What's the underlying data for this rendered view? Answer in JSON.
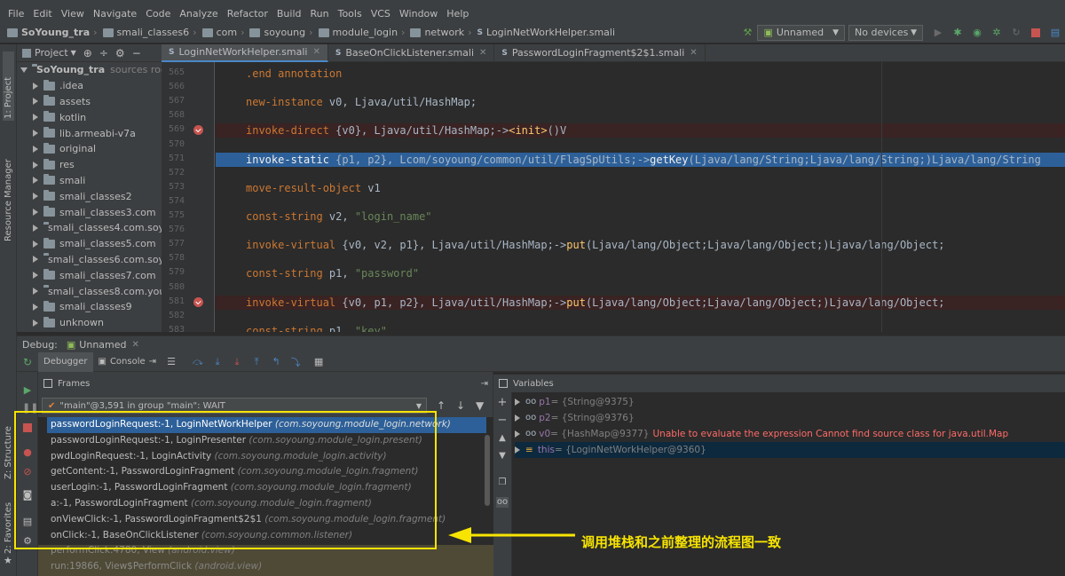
{
  "menu": [
    "File",
    "Edit",
    "View",
    "Navigate",
    "Code",
    "Analyze",
    "Refactor",
    "Build",
    "Run",
    "Tools",
    "VCS",
    "Window",
    "Help"
  ],
  "breadcrumbs": [
    "SoYoung_tra",
    "smali_classes6",
    "com",
    "soyoung",
    "module_login",
    "network",
    "LoginNetWorkHelper.smali"
  ],
  "toolbar": {
    "run_config": "Unnamed",
    "device": "No devices"
  },
  "project": {
    "header": "Project",
    "root": "SoYoung_tra",
    "root_suffix": "sources root",
    "items": [
      ".idea",
      "assets",
      "kotlin",
      "lib.armeabi-v7a",
      "original",
      "res",
      "smali",
      "smali_classes2",
      "smali_classes3.com",
      "smali_classes4.com.soy",
      "smali_classes5.com",
      "smali_classes6.com.soy",
      "smali_classes7.com",
      "smali_classes8.com.you",
      "smali_classes9",
      "unknown"
    ]
  },
  "side_tabs": {
    "project": "1: Project",
    "resource": "Resource Manager",
    "structure": "Z: Structure",
    "favorites": "2: Favorites"
  },
  "editor": {
    "tabs": [
      "LoginNetWorkHelper.smali",
      "BaseOnClickListener.smali",
      "PasswordLoginFragment$2$1.smali"
    ],
    "lines": [
      {
        "n": "565",
        "t": ".end annotation"
      },
      {
        "n": "566",
        "t": ""
      },
      {
        "n": "567",
        "t": "new-instance v0, Ljava/util/HashMap;"
      },
      {
        "n": "568",
        "t": ""
      },
      {
        "n": "569",
        "t": "invoke-direct {v0}, Ljava/util/HashMap;-><init>()V",
        "bp": true
      },
      {
        "n": "570",
        "t": ""
      },
      {
        "n": "571",
        "t": "invoke-static {p1, p2}, Lcom/soyoung/common/util/FlagSpUtils;->getKey(Ljava/lang/String;Ljava/lang/String;)Ljava/lang/String",
        "cur": true
      },
      {
        "n": "572",
        "t": ""
      },
      {
        "n": "573",
        "t": "move-result-object v1"
      },
      {
        "n": "574",
        "t": ""
      },
      {
        "n": "575",
        "t": "const-string v2, \"login_name\""
      },
      {
        "n": "576",
        "t": ""
      },
      {
        "n": "577",
        "t": "invoke-virtual {v0, v2, p1}, Ljava/util/HashMap;->put(Ljava/lang/Object;Ljava/lang/Object;)Ljava/lang/Object;"
      },
      {
        "n": "578",
        "t": ""
      },
      {
        "n": "579",
        "t": "const-string p1, \"password\""
      },
      {
        "n": "580",
        "t": ""
      },
      {
        "n": "581",
        "t": "invoke-virtual {v0, p1, p2}, Ljava/util/HashMap;->put(Ljava/lang/Object;Ljava/lang/Object;)Ljava/lang/Object;",
        "bp": true
      },
      {
        "n": "582",
        "t": ""
      },
      {
        "n": "583",
        "t": "const-string p1, \"key\""
      }
    ]
  },
  "debug": {
    "label": "Debug:",
    "session": "Unnamed",
    "tabs": {
      "debugger": "Debugger",
      "console": "Console"
    },
    "frames_title": "Frames",
    "variables_title": "Variables",
    "thread": "\"main\"@3,591 in group \"main\": WAIT",
    "frames": [
      {
        "m": "passwordLoginRequest:-1, LoginNetWorkHelper",
        "p": "(com.soyoung.module_login.network)",
        "sel": true
      },
      {
        "m": "passwordLoginRequest:-1, LoginPresenter",
        "p": "(com.soyoung.module_login.present)"
      },
      {
        "m": "pwdLoginRequest:-1, LoginActivity",
        "p": "(com.soyoung.module_login.activity)"
      },
      {
        "m": "getContent:-1, PasswordLoginFragment",
        "p": "(com.soyoung.module_login.fragment)"
      },
      {
        "m": "userLogin:-1, PasswordLoginFragment",
        "p": "(com.soyoung.module_login.fragment)"
      },
      {
        "m": "a:-1, PasswordLoginFragment",
        "p": "(com.soyoung.module_login.fragment)"
      },
      {
        "m": "onViewClick:-1, PasswordLoginFragment$2$1",
        "p": "(com.soyoung.module_login.fragment)"
      },
      {
        "m": "onClick:-1, BaseOnClickListener",
        "p": "(com.soyoung.common.listener)"
      },
      {
        "m": "performClick:4780, View",
        "p": "(android.view)",
        "lib": true
      },
      {
        "m": "run:19866, View$PerformClick",
        "p": "(android.view)",
        "lib": true
      }
    ],
    "variables": [
      {
        "name": "p1",
        "value": "= {String@9375}"
      },
      {
        "name": "p2",
        "value": "= {String@9376}"
      },
      {
        "name": "v0",
        "value": "= {HashMap@9377}",
        "error": "Unable to evaluate the expression Cannot find source class for java.util.Map"
      },
      {
        "name": "this",
        "value": "= {LoginNetWorkHelper@9360}",
        "sel": true
      }
    ]
  },
  "annotation": {
    "text": "调用堆栈和之前整理的流程图一致",
    "color": "#f7e400"
  }
}
